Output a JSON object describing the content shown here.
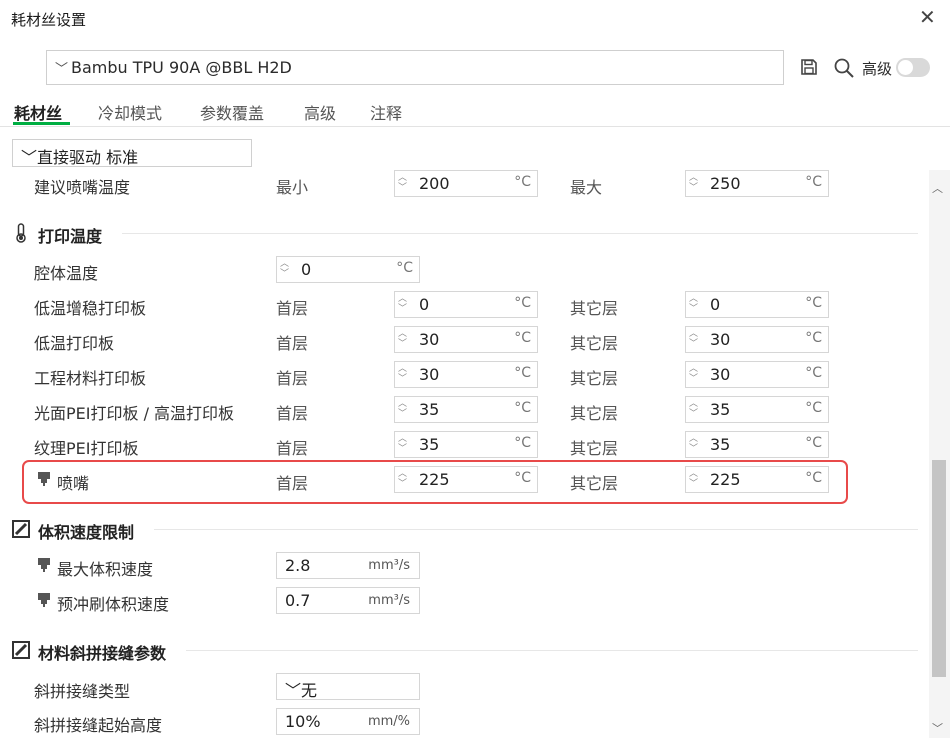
{
  "window": {
    "title": "耗材丝设置",
    "close_glyph": "✕"
  },
  "preset": {
    "chevron": "﹀",
    "name": "Bambu TPU 90A @BBL H2D"
  },
  "header": {
    "advanced_label": "高级",
    "advanced_on": false,
    "icons": [
      "save-icon",
      "search-icon"
    ]
  },
  "tabs": [
    {
      "label": "耗材丝",
      "active": true
    },
    {
      "label": "冷却模式",
      "active": false
    },
    {
      "label": "参数覆盖",
      "active": false
    },
    {
      "label": "高级",
      "active": false
    },
    {
      "label": "注释",
      "active": false
    }
  ],
  "variant": {
    "value": "直接驱动 标准"
  },
  "suggest_nozzle": {
    "label": "建议喷嘴温度",
    "min_label": "最小",
    "min_value": "200",
    "max_label": "最大",
    "max_value": "250",
    "unit": "°C"
  },
  "print_temp": {
    "title": "打印温度",
    "chamber": {
      "label": "腔体温度",
      "value": "0",
      "unit": "°C"
    },
    "first_layer_label": "首层",
    "other_layer_label": "其它层",
    "rows": [
      {
        "label": "低温增稳打印板",
        "first": "0",
        "other": "0",
        "unit": "°C"
      },
      {
        "label": "低温打印板",
        "first": "30",
        "other": "30",
        "unit": "°C"
      },
      {
        "label": "工程材料打印板",
        "first": "30",
        "other": "30",
        "unit": "°C"
      },
      {
        "label": "光面PEI打印板 / 高温打印板",
        "first": "35",
        "other": "35",
        "unit": "°C"
      },
      {
        "label": "纹理PEI打印板",
        "first": "35",
        "other": "35",
        "unit": "°C"
      },
      {
        "label": "喷嘴",
        "first": "225",
        "other": "225",
        "unit": "°C"
      }
    ]
  },
  "volumetric": {
    "title": "体积速度限制",
    "max_label": "最大体积速度",
    "max_value": "2.8",
    "max_unit": "mm³/s",
    "prime_label": "预冲刷体积速度",
    "prime_value": "0.7",
    "prime_unit": "mm³/s"
  },
  "scarf": {
    "title": "材料斜拼接缝参数",
    "type_label": "斜拼接缝类型",
    "type_value": "无",
    "start_label": "斜拼接缝起始高度",
    "start_value": "10%",
    "start_unit": "mm/%"
  },
  "colors": {
    "accent": "#00ae42",
    "highlight": "#e84a4a"
  }
}
